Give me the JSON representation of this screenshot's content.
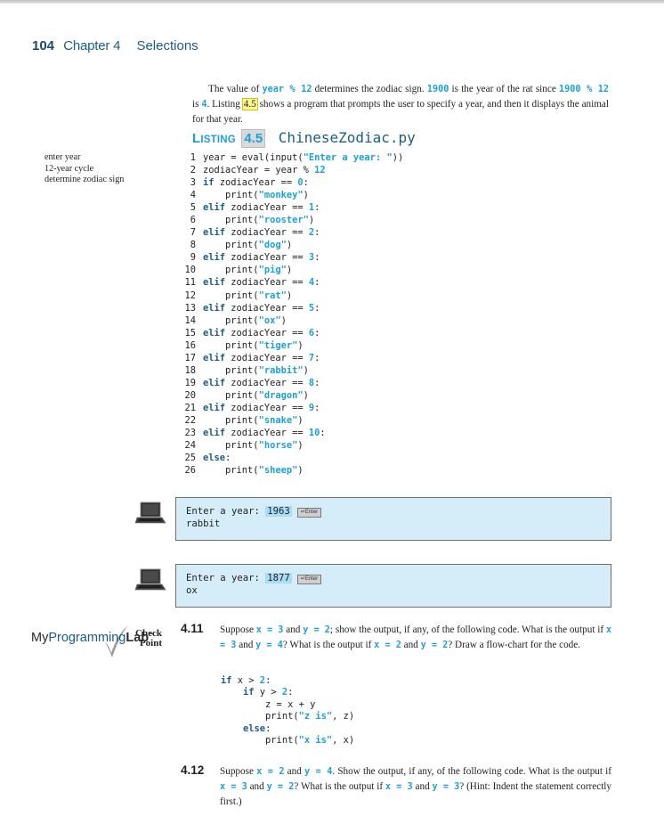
{
  "header": {
    "page_number": "104",
    "chapter": "Chapter 4",
    "section": "Selections"
  },
  "intro": {
    "t1": "The value of ",
    "c1": "year % 12",
    "t2": " determines the zodiac sign. ",
    "c2": "1900",
    "t3": " is the year of the rat since ",
    "c3": "1900 % 12",
    "t4": " is ",
    "c4": "4",
    "t5": ". Listing ",
    "listing_ref": "4.5",
    "t6": " shows a program that prompts the user to specify a year, and then it displays the animal for that year."
  },
  "listing": {
    "label_big": "L",
    "label_small": "ISTING",
    "number": "4.5",
    "filename": "ChineseZodiac.py",
    "margin_notes": [
      "enter year",
      "12-year cycle",
      "determine zodiac sign"
    ],
    "lines": [
      [
        [
          "",
          "year = eval(input("
        ],
        [
          "str",
          "\"Enter a year: \""
        ],
        [
          "",
          "))"
        ]
      ],
      [
        [
          "",
          "zodiacYear = year % "
        ],
        [
          "lit",
          "12"
        ]
      ],
      [
        [
          "kw",
          "if"
        ],
        [
          "",
          " zodiacYear == "
        ],
        [
          "lit",
          "0"
        ],
        [
          "",
          ":"
        ]
      ],
      [
        [
          "",
          "    print("
        ],
        [
          "str",
          "\"monkey\""
        ],
        [
          "",
          ")"
        ]
      ],
      [
        [
          "kw",
          "elif"
        ],
        [
          "",
          " zodiacYear == "
        ],
        [
          "lit",
          "1"
        ],
        [
          "",
          ":"
        ]
      ],
      [
        [
          "",
          "    print("
        ],
        [
          "str",
          "\"rooster\""
        ],
        [
          "",
          ")"
        ]
      ],
      [
        [
          "kw",
          "elif"
        ],
        [
          "",
          " zodiacYear == "
        ],
        [
          "lit",
          "2"
        ],
        [
          "",
          ":"
        ]
      ],
      [
        [
          "",
          "    print("
        ],
        [
          "str",
          "\"dog\""
        ],
        [
          "",
          ")"
        ]
      ],
      [
        [
          "kw",
          "elif"
        ],
        [
          "",
          " zodiacYear == "
        ],
        [
          "lit",
          "3"
        ],
        [
          "",
          ":"
        ]
      ],
      [
        [
          "",
          "    print("
        ],
        [
          "str",
          "\"pig\""
        ],
        [
          "",
          ")"
        ]
      ],
      [
        [
          "kw",
          "elif"
        ],
        [
          "",
          " zodiacYear == "
        ],
        [
          "lit",
          "4"
        ],
        [
          "",
          ":"
        ]
      ],
      [
        [
          "",
          "    print("
        ],
        [
          "str",
          "\"rat\""
        ],
        [
          "",
          ")"
        ]
      ],
      [
        [
          "kw",
          "elif"
        ],
        [
          "",
          " zodiacYear == "
        ],
        [
          "lit",
          "5"
        ],
        [
          "",
          ":"
        ]
      ],
      [
        [
          "",
          "    print("
        ],
        [
          "str",
          "\"ox\""
        ],
        [
          "",
          ")"
        ]
      ],
      [
        [
          "kw",
          "elif"
        ],
        [
          "",
          " zodiacYear == "
        ],
        [
          "lit",
          "6"
        ],
        [
          "",
          ":"
        ]
      ],
      [
        [
          "",
          "    print("
        ],
        [
          "str",
          "\"tiger\""
        ],
        [
          "",
          ")"
        ]
      ],
      [
        [
          "kw",
          "elif"
        ],
        [
          "",
          " zodiacYear == "
        ],
        [
          "lit",
          "7"
        ],
        [
          "",
          ":"
        ]
      ],
      [
        [
          "",
          "    print("
        ],
        [
          "str",
          "\"rabbit\""
        ],
        [
          "",
          ")"
        ]
      ],
      [
        [
          "kw",
          "elif"
        ],
        [
          "",
          " zodiacYear == "
        ],
        [
          "lit",
          "8"
        ],
        [
          "",
          ":"
        ]
      ],
      [
        [
          "",
          "    print("
        ],
        [
          "str",
          "\"dragon\""
        ],
        [
          "",
          ")"
        ]
      ],
      [
        [
          "kw",
          "elif"
        ],
        [
          "",
          " zodiacYear == "
        ],
        [
          "lit",
          "9"
        ],
        [
          "",
          ":"
        ]
      ],
      [
        [
          "",
          "    print("
        ],
        [
          "str",
          "\"snake\""
        ],
        [
          "",
          ")"
        ]
      ],
      [
        [
          "kw",
          "elif"
        ],
        [
          "",
          " zodiacYear == "
        ],
        [
          "lit",
          "10"
        ],
        [
          "",
          ":"
        ]
      ],
      [
        [
          "",
          "    print("
        ],
        [
          "str",
          "\"horse\""
        ],
        [
          "",
          ")"
        ]
      ],
      [
        [
          "kw",
          "else"
        ],
        [
          "",
          ":"
        ]
      ],
      [
        [
          "",
          "    print("
        ],
        [
          "str",
          "\"sheep\""
        ],
        [
          "",
          ")"
        ]
      ]
    ]
  },
  "sample_runs": [
    {
      "prompt": "Enter a year: ",
      "input": "1963",
      "key": "↵Enter",
      "output": "rabbit"
    },
    {
      "prompt": "Enter a year: ",
      "input": "1877",
      "key": "↵Enter",
      "output": "ox"
    }
  ],
  "sidebar": {
    "checkpoint_line1": "Check",
    "checkpoint_line2": "Point",
    "mpl_my": "My",
    "mpl_programming": "Programming",
    "mpl_lab": "Lab",
    "mpl_tm": "™"
  },
  "questions": [
    {
      "number": "4.11",
      "text": [
        [
          "t",
          "Suppose "
        ],
        [
          "c",
          "x = 3"
        ],
        [
          "t",
          " and "
        ],
        [
          "c",
          "y = 2"
        ],
        [
          "t",
          "; show the output, if any, of the following code. What is the output if "
        ],
        [
          "c",
          "x = 3"
        ],
        [
          "t",
          " and "
        ],
        [
          "c",
          "y = 4"
        ],
        [
          "t",
          "? What is the output if "
        ],
        [
          "c",
          "x = 2"
        ],
        [
          "t",
          " and "
        ],
        [
          "c",
          "y = 2"
        ],
        [
          "t",
          "? Draw a flow-chart for the code."
        ]
      ],
      "code": [
        [
          [
            "kw",
            "if"
          ],
          [
            "",
            " x > "
          ],
          [
            "lit",
            "2"
          ],
          [
            "",
            ":"
          ]
        ],
        [
          [
            "",
            "    "
          ],
          [
            "kw",
            "if"
          ],
          [
            "",
            " y > "
          ],
          [
            "lit",
            "2"
          ],
          [
            "",
            ":"
          ]
        ],
        [
          [
            "",
            "        z = x + y"
          ]
        ],
        [
          [
            "",
            "        print("
          ],
          [
            "str",
            "\"z is\""
          ],
          [
            "",
            ", z)"
          ]
        ],
        [
          [
            "",
            "    "
          ],
          [
            "kw",
            "else"
          ],
          [
            "",
            ":"
          ]
        ],
        [
          [
            "",
            "        print("
          ],
          [
            "str",
            "\"x is\""
          ],
          [
            "",
            ", x)"
          ]
        ]
      ]
    },
    {
      "number": "4.12",
      "text": [
        [
          "t",
          "Suppose "
        ],
        [
          "c",
          "x = 2"
        ],
        [
          "t",
          " and "
        ],
        [
          "c",
          "y = 4"
        ],
        [
          "t",
          ". Show the output, if any, of the following code. What is the output if "
        ],
        [
          "c",
          "x = 3"
        ],
        [
          "t",
          " and "
        ],
        [
          "c",
          "y = 2"
        ],
        [
          "t",
          "? What is the output if "
        ],
        [
          "c",
          "x = 3"
        ],
        [
          "t",
          " and "
        ],
        [
          "c",
          "y = 3"
        ],
        [
          "t",
          "? (Hint: Indent the statement correctly first.)"
        ]
      ]
    }
  ]
}
